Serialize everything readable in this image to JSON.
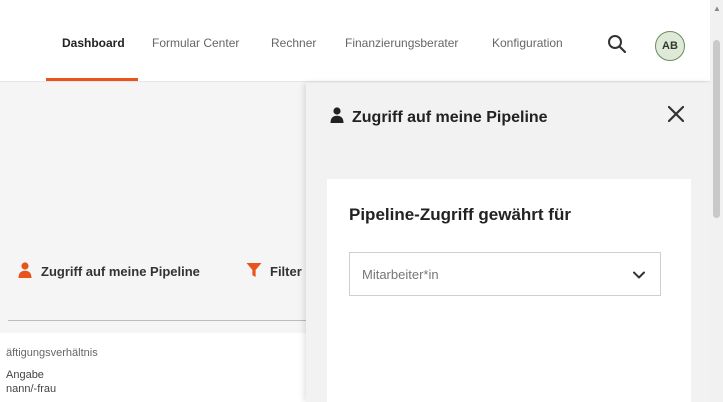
{
  "nav": {
    "items": [
      {
        "label": "Dashboard",
        "active": true
      },
      {
        "label": "Formular Center",
        "active": false
      },
      {
        "label": "Rechner",
        "active": false
      },
      {
        "label": "Finanzierungsberater",
        "active": false
      },
      {
        "label": "Konfiguration",
        "active": false
      }
    ],
    "search_icon": "search-icon",
    "avatar_initials": "AB"
  },
  "toolbar": {
    "pipeline_label": "Zugriff auf meine Pipeline",
    "filter_label": "Filter",
    "pipeline_icon": "person-icon",
    "filter_icon": "funnel-icon"
  },
  "table": {
    "column_header": "äftigungsverhältnis",
    "rows": [
      "Angabe",
      "nann/-frau"
    ]
  },
  "panel": {
    "title": "Zugriff auf meine Pipeline",
    "close_icon": "close-icon",
    "card_title": "Pipeline-Zugriff gewährt für",
    "select_placeholder": "Mitarbeiter*in"
  },
  "colors": {
    "accent": "#e8541c",
    "avatar_bg": "#dfe9d8",
    "avatar_border": "#6a8b5c",
    "panel_bg": "#f2f2f2"
  }
}
